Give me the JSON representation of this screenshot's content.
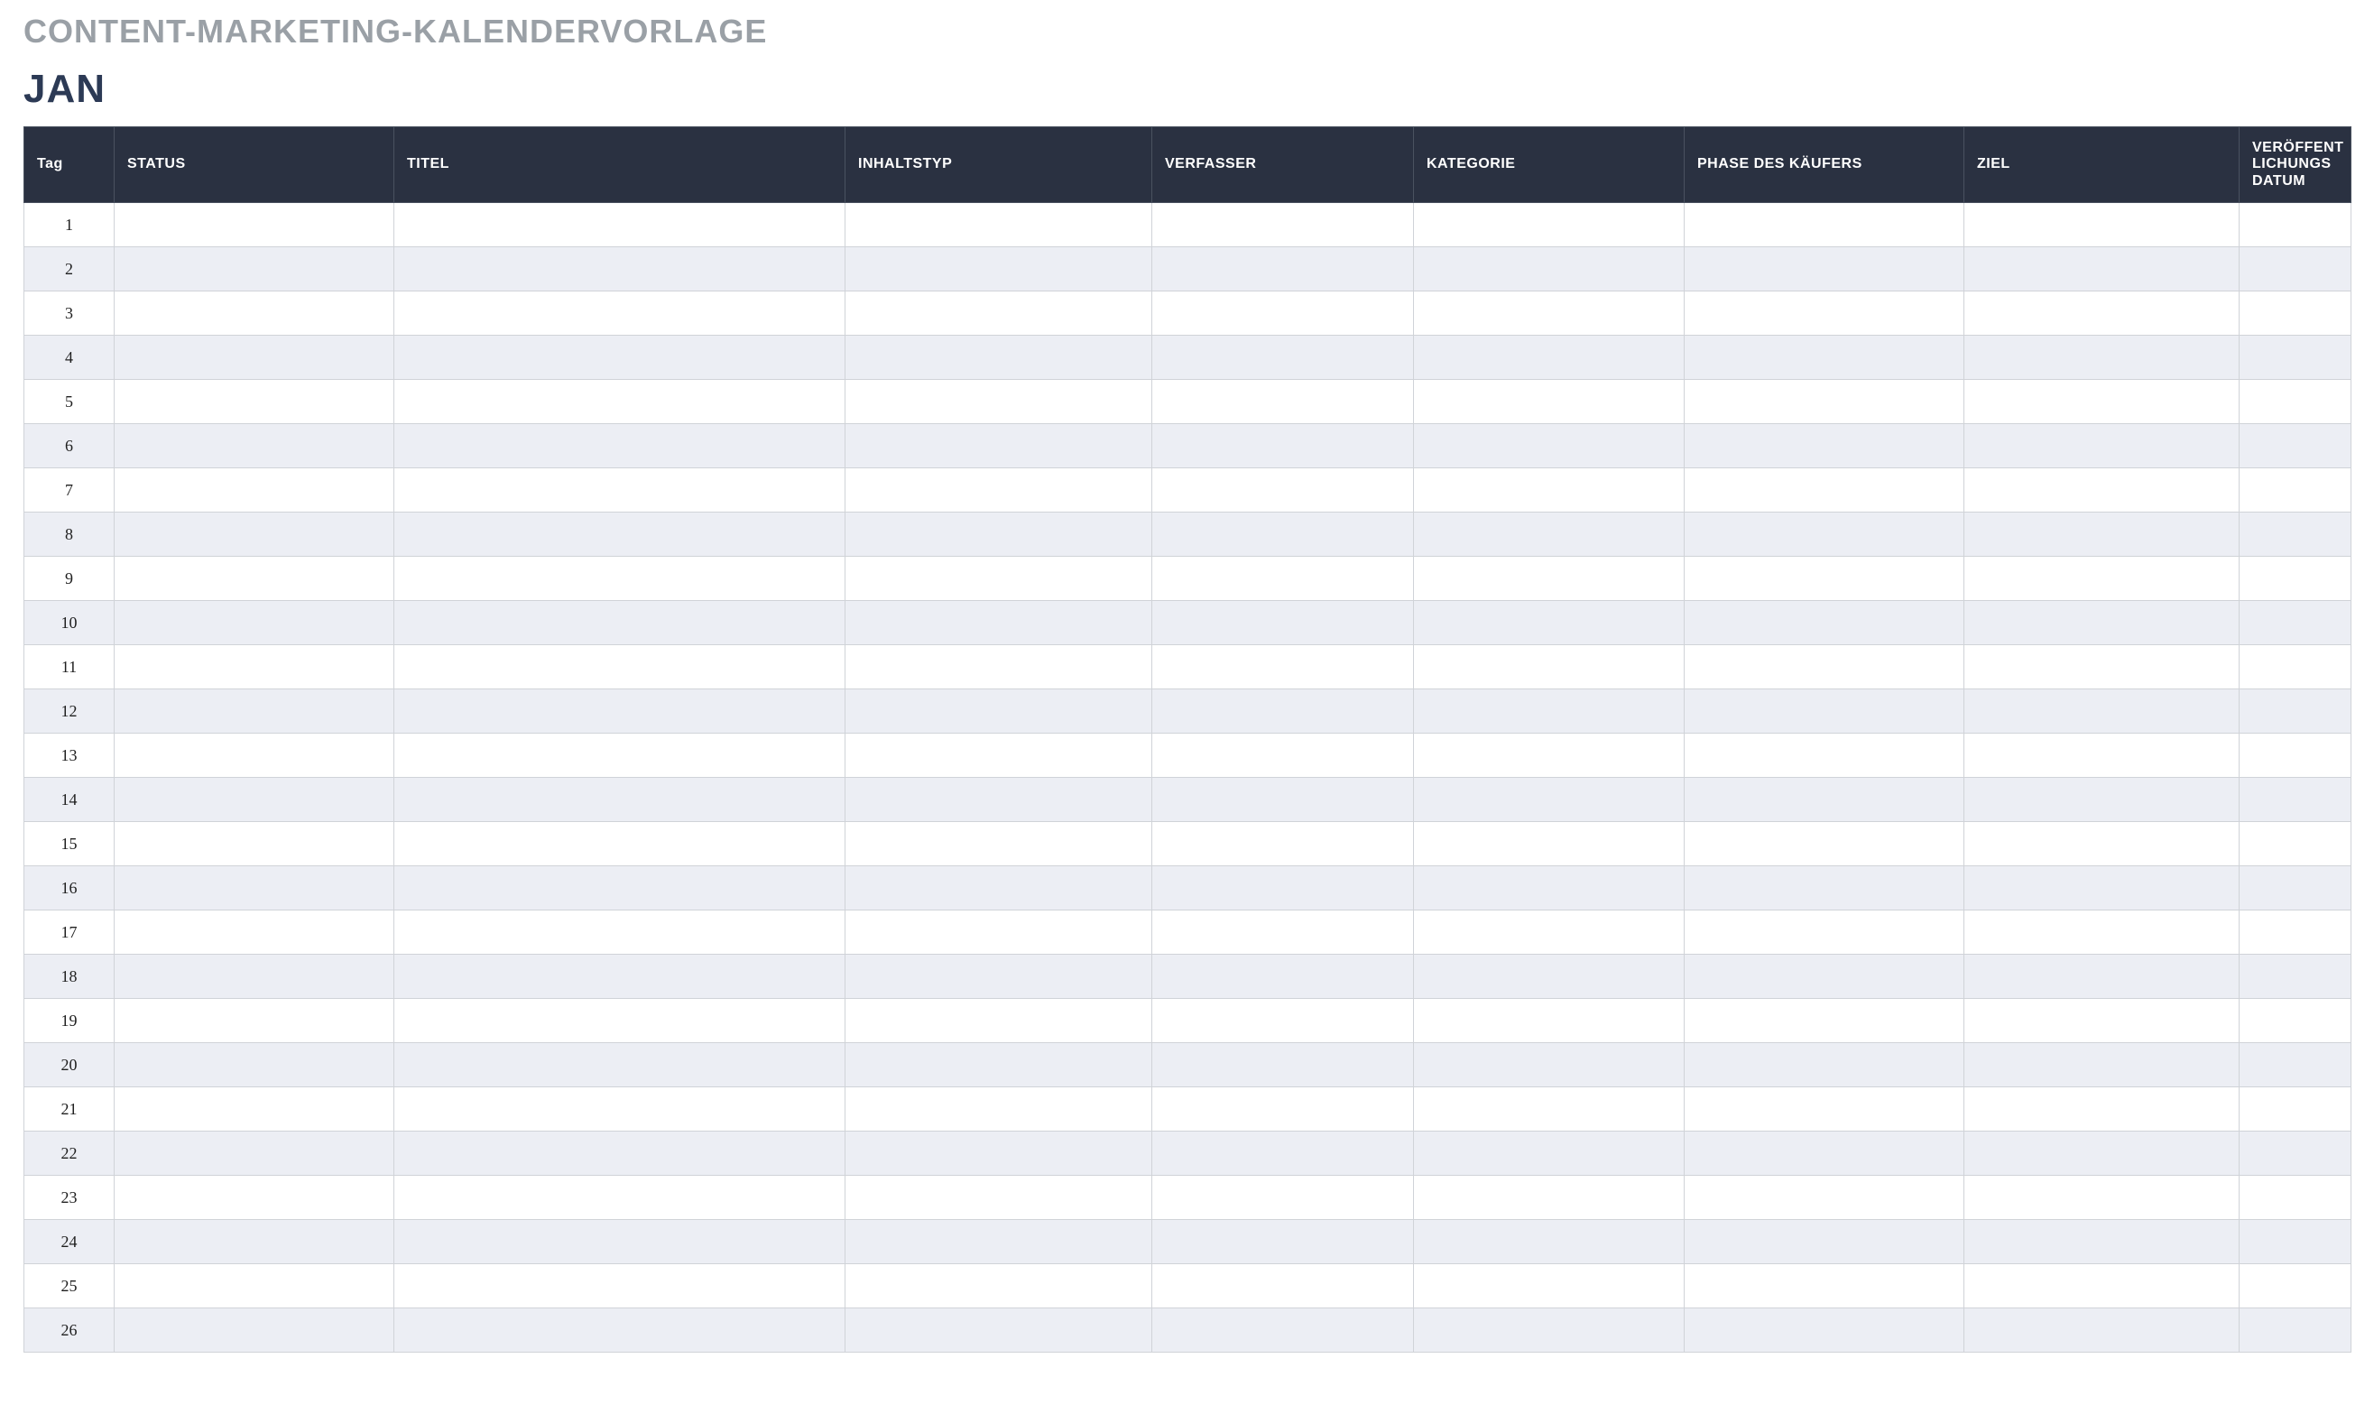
{
  "document": {
    "title": "CONTENT-MARKETING-KALENDERVORLAGE",
    "month": "JAN"
  },
  "table": {
    "headers": {
      "tag": "Tag",
      "status": "STATUS",
      "titel": "TITEL",
      "inhaltstyp": "INHALTSTYP",
      "verfasser": "VERFASSER",
      "kategorie": "KATEGORIE",
      "phase": "PHASE DES KÄUFERS",
      "ziel": "ZIEL",
      "datum": "VERÖFFENT\nLICHUNGS\nDATUM"
    },
    "rows": [
      {
        "tag": "1",
        "status": "",
        "titel": "",
        "inhaltstyp": "",
        "verfasser": "",
        "kategorie": "",
        "phase": "",
        "ziel": "",
        "datum": ""
      },
      {
        "tag": "2",
        "status": "",
        "titel": "",
        "inhaltstyp": "",
        "verfasser": "",
        "kategorie": "",
        "phase": "",
        "ziel": "",
        "datum": ""
      },
      {
        "tag": "3",
        "status": "",
        "titel": "",
        "inhaltstyp": "",
        "verfasser": "",
        "kategorie": "",
        "phase": "",
        "ziel": "",
        "datum": ""
      },
      {
        "tag": "4",
        "status": "",
        "titel": "",
        "inhaltstyp": "",
        "verfasser": "",
        "kategorie": "",
        "phase": "",
        "ziel": "",
        "datum": ""
      },
      {
        "tag": "5",
        "status": "",
        "titel": "",
        "inhaltstyp": "",
        "verfasser": "",
        "kategorie": "",
        "phase": "",
        "ziel": "",
        "datum": ""
      },
      {
        "tag": "6",
        "status": "",
        "titel": "",
        "inhaltstyp": "",
        "verfasser": "",
        "kategorie": "",
        "phase": "",
        "ziel": "",
        "datum": ""
      },
      {
        "tag": "7",
        "status": "",
        "titel": "",
        "inhaltstyp": "",
        "verfasser": "",
        "kategorie": "",
        "phase": "",
        "ziel": "",
        "datum": ""
      },
      {
        "tag": "8",
        "status": "",
        "titel": "",
        "inhaltstyp": "",
        "verfasser": "",
        "kategorie": "",
        "phase": "",
        "ziel": "",
        "datum": ""
      },
      {
        "tag": "9",
        "status": "",
        "titel": "",
        "inhaltstyp": "",
        "verfasser": "",
        "kategorie": "",
        "phase": "",
        "ziel": "",
        "datum": ""
      },
      {
        "tag": "10",
        "status": "",
        "titel": "",
        "inhaltstyp": "",
        "verfasser": "",
        "kategorie": "",
        "phase": "",
        "ziel": "",
        "datum": ""
      },
      {
        "tag": "11",
        "status": "",
        "titel": "",
        "inhaltstyp": "",
        "verfasser": "",
        "kategorie": "",
        "phase": "",
        "ziel": "",
        "datum": ""
      },
      {
        "tag": "12",
        "status": "",
        "titel": "",
        "inhaltstyp": "",
        "verfasser": "",
        "kategorie": "",
        "phase": "",
        "ziel": "",
        "datum": ""
      },
      {
        "tag": "13",
        "status": "",
        "titel": "",
        "inhaltstyp": "",
        "verfasser": "",
        "kategorie": "",
        "phase": "",
        "ziel": "",
        "datum": ""
      },
      {
        "tag": "14",
        "status": "",
        "titel": "",
        "inhaltstyp": "",
        "verfasser": "",
        "kategorie": "",
        "phase": "",
        "ziel": "",
        "datum": ""
      },
      {
        "tag": "15",
        "status": "",
        "titel": "",
        "inhaltstyp": "",
        "verfasser": "",
        "kategorie": "",
        "phase": "",
        "ziel": "",
        "datum": ""
      },
      {
        "tag": "16",
        "status": "",
        "titel": "",
        "inhaltstyp": "",
        "verfasser": "",
        "kategorie": "",
        "phase": "",
        "ziel": "",
        "datum": ""
      },
      {
        "tag": "17",
        "status": "",
        "titel": "",
        "inhaltstyp": "",
        "verfasser": "",
        "kategorie": "",
        "phase": "",
        "ziel": "",
        "datum": ""
      },
      {
        "tag": "18",
        "status": "",
        "titel": "",
        "inhaltstyp": "",
        "verfasser": "",
        "kategorie": "",
        "phase": "",
        "ziel": "",
        "datum": ""
      },
      {
        "tag": "19",
        "status": "",
        "titel": "",
        "inhaltstyp": "",
        "verfasser": "",
        "kategorie": "",
        "phase": "",
        "ziel": "",
        "datum": ""
      },
      {
        "tag": "20",
        "status": "",
        "titel": "",
        "inhaltstyp": "",
        "verfasser": "",
        "kategorie": "",
        "phase": "",
        "ziel": "",
        "datum": ""
      },
      {
        "tag": "21",
        "status": "",
        "titel": "",
        "inhaltstyp": "",
        "verfasser": "",
        "kategorie": "",
        "phase": "",
        "ziel": "",
        "datum": ""
      },
      {
        "tag": "22",
        "status": "",
        "titel": "",
        "inhaltstyp": "",
        "verfasser": "",
        "kategorie": "",
        "phase": "",
        "ziel": "",
        "datum": ""
      },
      {
        "tag": "23",
        "status": "",
        "titel": "",
        "inhaltstyp": "",
        "verfasser": "",
        "kategorie": "",
        "phase": "",
        "ziel": "",
        "datum": ""
      },
      {
        "tag": "24",
        "status": "",
        "titel": "",
        "inhaltstyp": "",
        "verfasser": "",
        "kategorie": "",
        "phase": "",
        "ziel": "",
        "datum": ""
      },
      {
        "tag": "25",
        "status": "",
        "titel": "",
        "inhaltstyp": "",
        "verfasser": "",
        "kategorie": "",
        "phase": "",
        "ziel": "",
        "datum": ""
      },
      {
        "tag": "26",
        "status": "",
        "titel": "",
        "inhaltstyp": "",
        "verfasser": "",
        "kategorie": "",
        "phase": "",
        "ziel": "",
        "datum": ""
      }
    ]
  }
}
